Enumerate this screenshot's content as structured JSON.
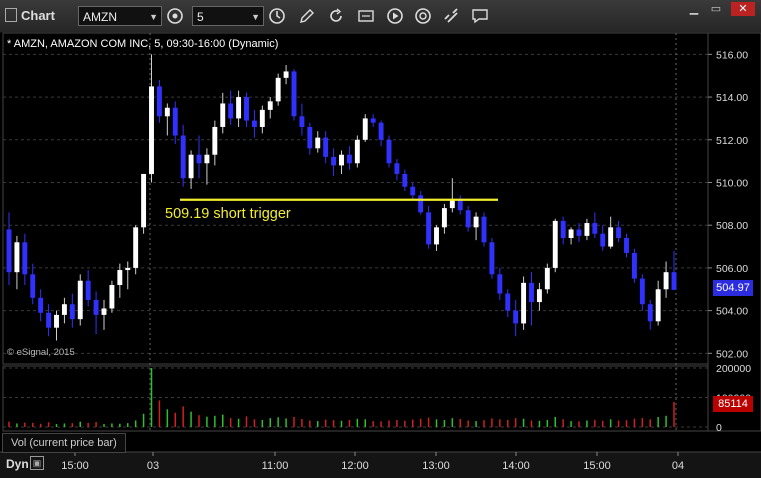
{
  "window": {
    "title": "Chart"
  },
  "toolbar": {
    "symbol": "AMZN",
    "interval": "5",
    "icons": [
      "interval-clock-icon",
      "pencil-icon",
      "refresh-icon",
      "cursor-mode-icon",
      "play-icon",
      "link-icon",
      "comment-icon"
    ]
  },
  "chart": {
    "title": "* AMZN, AMAZON COM INC, 5, 09:30-16:00 (Dynamic)",
    "annotation": "509.19 short trigger",
    "credit": "© eSignal, 2015",
    "last_price": "504.97",
    "current_volume": "85114",
    "volume_label": "Vol (current price bar)",
    "dyn": "Dyn",
    "colors": {
      "up": "#ffffff",
      "down": "#3030ff",
      "trigger": "#f3ee2e",
      "vol_up": "#2fbf2f",
      "vol_down": "#d02020"
    }
  },
  "chart_data": {
    "type": "candlestick",
    "title": "* AMZN, AMAZON COM INC, 5, 09:30-16:00 (Dynamic)",
    "ylim": [
      501.5,
      517
    ],
    "y_ticks": [
      "516.00",
      "514.00",
      "512.00",
      "510.00",
      "508.00",
      "506.00",
      "504.00",
      "502.00"
    ],
    "x_ticks": [
      "15:00",
      "03",
      "11:00",
      "12:00",
      "13:00",
      "14:00",
      "15:00",
      "04"
    ],
    "trigger_level": 509.19,
    "volume_ticks": [
      "200000",
      "100000",
      "0"
    ],
    "volume_ylim": [
      0,
      200000
    ],
    "candles": [
      [
        507.8,
        508.6,
        505.2,
        505.8
      ],
      [
        505.8,
        507.5,
        505.0,
        507.2
      ],
      [
        507.2,
        507.6,
        505.2,
        505.7
      ],
      [
        505.7,
        506.2,
        504.3,
        504.6
      ],
      [
        504.6,
        505.0,
        503.5,
        503.9
      ],
      [
        503.9,
        504.3,
        502.8,
        503.2
      ],
      [
        503.2,
        504.0,
        502.6,
        503.8
      ],
      [
        503.8,
        504.6,
        503.4,
        504.3
      ],
      [
        504.3,
        504.8,
        503.2,
        503.6
      ],
      [
        503.6,
        505.7,
        503.3,
        505.4
      ],
      [
        505.4,
        505.9,
        504.2,
        504.5
      ],
      [
        504.5,
        504.9,
        502.9,
        503.8
      ],
      [
        503.8,
        504.5,
        503.1,
        504.1
      ],
      [
        504.1,
        505.4,
        503.9,
        505.2
      ],
      [
        505.2,
        506.2,
        504.6,
        505.9
      ],
      [
        505.9,
        506.3,
        505.0,
        506.0
      ],
      [
        506.0,
        508.0,
        505.7,
        507.9
      ],
      [
        507.9,
        510.4,
        507.6,
        510.4
      ],
      [
        510.4,
        516.0,
        510.0,
        514.5
      ],
      [
        514.5,
        514.8,
        512.8,
        513.1
      ],
      [
        513.1,
        513.7,
        512.2,
        513.5
      ],
      [
        513.5,
        513.8,
        511.8,
        512.2
      ],
      [
        512.2,
        512.7,
        509.8,
        510.2
      ],
      [
        510.2,
        511.5,
        509.7,
        511.3
      ],
      [
        511.3,
        512.2,
        510.2,
        510.9
      ],
      [
        510.9,
        511.6,
        509.9,
        511.3
      ],
      [
        511.3,
        512.9,
        510.8,
        512.6
      ],
      [
        512.6,
        514.2,
        512.3,
        513.7
      ],
      [
        513.7,
        514.3,
        512.7,
        513.0
      ],
      [
        513.0,
        514.3,
        512.6,
        514.0
      ],
      [
        514.0,
        514.2,
        512.6,
        512.9
      ],
      [
        512.9,
        513.4,
        512.1,
        512.6
      ],
      [
        512.6,
        513.6,
        512.3,
        513.4
      ],
      [
        513.4,
        514.0,
        513.0,
        513.8
      ],
      [
        513.8,
        515.1,
        513.6,
        514.9
      ],
      [
        514.9,
        515.5,
        514.6,
        515.2
      ],
      [
        515.2,
        515.3,
        512.9,
        513.1
      ],
      [
        513.1,
        513.7,
        512.2,
        512.6
      ],
      [
        512.6,
        512.8,
        511.3,
        511.6
      ],
      [
        511.6,
        512.4,
        511.4,
        512.1
      ],
      [
        512.1,
        512.4,
        510.9,
        511.2
      ],
      [
        511.2,
        511.6,
        510.3,
        510.8
      ],
      [
        510.8,
        511.5,
        510.4,
        511.3
      ],
      [
        511.3,
        511.7,
        510.6,
        510.9
      ],
      [
        510.9,
        512.2,
        510.7,
        512.0
      ],
      [
        512.0,
        513.2,
        511.9,
        513.0
      ],
      [
        513.0,
        513.2,
        512.6,
        512.8
      ],
      [
        512.8,
        512.9,
        511.7,
        512.0
      ],
      [
        512.0,
        512.2,
        510.7,
        510.9
      ],
      [
        510.9,
        511.1,
        510.1,
        510.4
      ],
      [
        510.4,
        510.6,
        509.6,
        509.8
      ],
      [
        509.8,
        510.0,
        509.2,
        509.4
      ],
      [
        509.4,
        509.6,
        508.5,
        508.6
      ],
      [
        508.6,
        508.9,
        506.9,
        507.1
      ],
      [
        507.1,
        508.0,
        506.8,
        507.9
      ],
      [
        507.9,
        509.0,
        507.6,
        508.8
      ],
      [
        508.8,
        510.2,
        508.6,
        509.2
      ],
      [
        509.2,
        509.4,
        508.5,
        508.7
      ],
      [
        508.7,
        508.9,
        507.7,
        507.9
      ],
      [
        507.9,
        508.6,
        507.3,
        508.4
      ],
      [
        508.4,
        508.6,
        507.0,
        507.2
      ],
      [
        507.2,
        507.4,
        505.5,
        505.7
      ],
      [
        505.7,
        506.0,
        504.5,
        504.8
      ],
      [
        504.8,
        505.0,
        503.7,
        504.0
      ],
      [
        504.0,
        504.5,
        502.8,
        503.4
      ],
      [
        503.4,
        505.6,
        503.1,
        505.3
      ],
      [
        505.3,
        505.8,
        503.3,
        504.4
      ],
      [
        504.4,
        505.3,
        504.0,
        505.0
      ],
      [
        505.0,
        506.2,
        504.8,
        506.0
      ],
      [
        506.0,
        508.3,
        505.8,
        508.2
      ],
      [
        508.2,
        508.4,
        507.1,
        507.4
      ],
      [
        507.4,
        507.9,
        507.1,
        507.8
      ],
      [
        507.8,
        508.1,
        507.2,
        507.5
      ],
      [
        507.5,
        508.3,
        507.3,
        508.1
      ],
      [
        508.1,
        508.6,
        507.4,
        507.6
      ],
      [
        507.6,
        508.0,
        506.8,
        507.0
      ],
      [
        507.0,
        508.4,
        506.9,
        507.9
      ],
      [
        507.9,
        508.2,
        507.2,
        507.4
      ],
      [
        507.4,
        507.6,
        506.5,
        506.7
      ],
      [
        506.7,
        506.9,
        505.3,
        505.5
      ],
      [
        505.5,
        505.7,
        504.0,
        504.3
      ],
      [
        504.3,
        504.5,
        503.1,
        503.5
      ],
      [
        503.5,
        505.4,
        503.3,
        505.0
      ],
      [
        505.0,
        506.3,
        504.6,
        505.8
      ],
      [
        505.8,
        506.8,
        505.2,
        504.97
      ]
    ],
    "volumes": [
      18000,
      12000,
      15000,
      14000,
      11000,
      16000,
      10000,
      12000,
      13000,
      18000,
      14000,
      17000,
      10000,
      12000,
      11000,
      13000,
      22000,
      45000,
      200000,
      90000,
      60000,
      48000,
      70000,
      52000,
      40000,
      35000,
      38000,
      42000,
      30000,
      28000,
      36000,
      26000,
      24000,
      30000,
      33000,
      29000,
      34000,
      27000,
      22000,
      20000,
      25000,
      23000,
      21000,
      24000,
      28000,
      26000,
      20000,
      19000,
      22000,
      24000,
      21000,
      25000,
      28000,
      32000,
      26000,
      24000,
      30000,
      27000,
      22000,
      20000,
      23000,
      29000,
      26000,
      24000,
      30000,
      28000,
      22000,
      21000,
      24000,
      34000,
      26000,
      20000,
      19000,
      22000,
      24000,
      21000,
      26000,
      22000,
      23000,
      28000,
      30000,
      26000,
      34000,
      38000,
      85114
    ]
  }
}
